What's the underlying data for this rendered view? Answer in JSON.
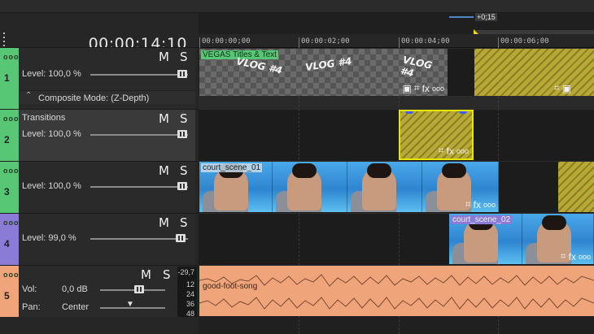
{
  "timecode": "00:00:14;10",
  "marker_label": "+0;15",
  "ruler": [
    "00:00:00;00",
    "00:00:02;00",
    "00:00:04;00",
    "00:00:06;00"
  ],
  "tracks": [
    {
      "number": "1",
      "dots": "ooo",
      "m": "M",
      "s": "S",
      "level": "Level: 100,0 %",
      "color": "#58c775",
      "composite": "Composite Mode: (Z-Depth)"
    },
    {
      "number": "2",
      "dots": "ooo",
      "m": "M",
      "s": "S",
      "name": "Transitions",
      "level": "Level: 100,0 %",
      "color": "#58c775"
    },
    {
      "number": "3",
      "dots": "ooo",
      "m": "M",
      "s": "S",
      "level": "Level: 100,0 %",
      "color": "#58c775"
    },
    {
      "number": "4",
      "dots": "ooo",
      "m": "M",
      "s": "S",
      "level": "Level: 99,0 %",
      "color": "#8a7bd6"
    },
    {
      "number": "5",
      "dots": "ooo",
      "m": "M",
      "s": "S",
      "vol_label": "Vol:",
      "vol_value": "0,0 dB",
      "pan_label": "Pan:",
      "pan_value": "Center",
      "color": "#f0a47a"
    }
  ],
  "meter": {
    "peak": "-29,7",
    "scale": [
      "12",
      "24",
      "36",
      "48"
    ]
  },
  "clips": {
    "titles": {
      "label": "VEGAS Titles & Text",
      "text": [
        "VLOG #4",
        "VLOG #4",
        "VLOG #4"
      ]
    },
    "video1": {
      "label": "court_scene_01"
    },
    "video2": {
      "label": "court_scene_02"
    },
    "audio": {
      "label": "good-foot-song"
    }
  },
  "icons": {
    "fx": "fx",
    "more": "ooo"
  }
}
